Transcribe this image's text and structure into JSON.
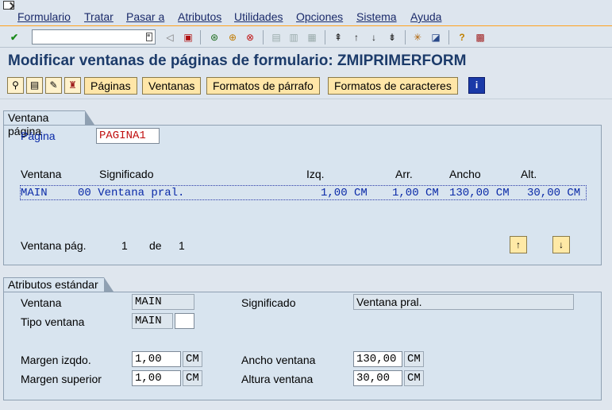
{
  "menu": {
    "items": [
      "Formulario",
      "Tratar",
      "Pasar a",
      "Atributos",
      "Utilidades",
      "Opciones",
      "Sistema",
      "Ayuda"
    ]
  },
  "toolbar": {
    "command_value": "",
    "icons": [
      "enter-icon",
      "back-icon",
      "save-icon",
      "back-nav-icon",
      "exit-icon",
      "cancel-icon",
      "print-icon",
      "find-icon",
      "find-next-icon",
      "first-page-icon",
      "prev-page-icon",
      "next-page-icon",
      "last-page-icon",
      "new-session-icon",
      "shortcut-icon",
      "help-icon",
      "layout-icon"
    ]
  },
  "title": "Modificar ventanas de páginas de formulario: ZMIPRIMERFORM",
  "appbar": {
    "buttons": [
      "Páginas",
      "Ventanas",
      "Formatos de párrafo",
      "Formatos de caracteres"
    ]
  },
  "ventana_pagina": {
    "group_title": "Ventana página",
    "pagina_label": "Página",
    "pagina_value": "PAGINA1",
    "columns": [
      "Ventana",
      "Significado",
      "Izq.",
      "Arr.",
      "Ancho",
      "Alt."
    ],
    "row": {
      "ventana": "MAIN",
      "significado": "00 Ventana pral.",
      "izq": "1,00 CM",
      "arr": "1,00 CM",
      "ancho": "130,00 CM",
      "alt": "30,00 CM"
    },
    "footer_label": "Ventana pág.",
    "footer_current": "1",
    "footer_de": "de",
    "footer_total": "1"
  },
  "atributos": {
    "group_title": "Atributos estándar",
    "ventana_label": "Ventana",
    "ventana_value": "MAIN",
    "significado_label": "Significado",
    "significado_value": "Ventana pral.",
    "tipo_label": "Tipo ventana",
    "tipo_value": "MAIN",
    "tipo_extra": "",
    "margen_izq_label": "Margen izqdo.",
    "margen_izq_value": "1,00",
    "margen_izq_unit": "CM",
    "margen_sup_label": "Margen superior",
    "margen_sup_value": "1,00",
    "margen_sup_unit": "CM",
    "ancho_label": "Ancho ventana",
    "ancho_value": "130,00",
    "ancho_unit": "CM",
    "altura_label": "Altura ventana",
    "altura_value": "30,00",
    "altura_unit": "CM"
  }
}
